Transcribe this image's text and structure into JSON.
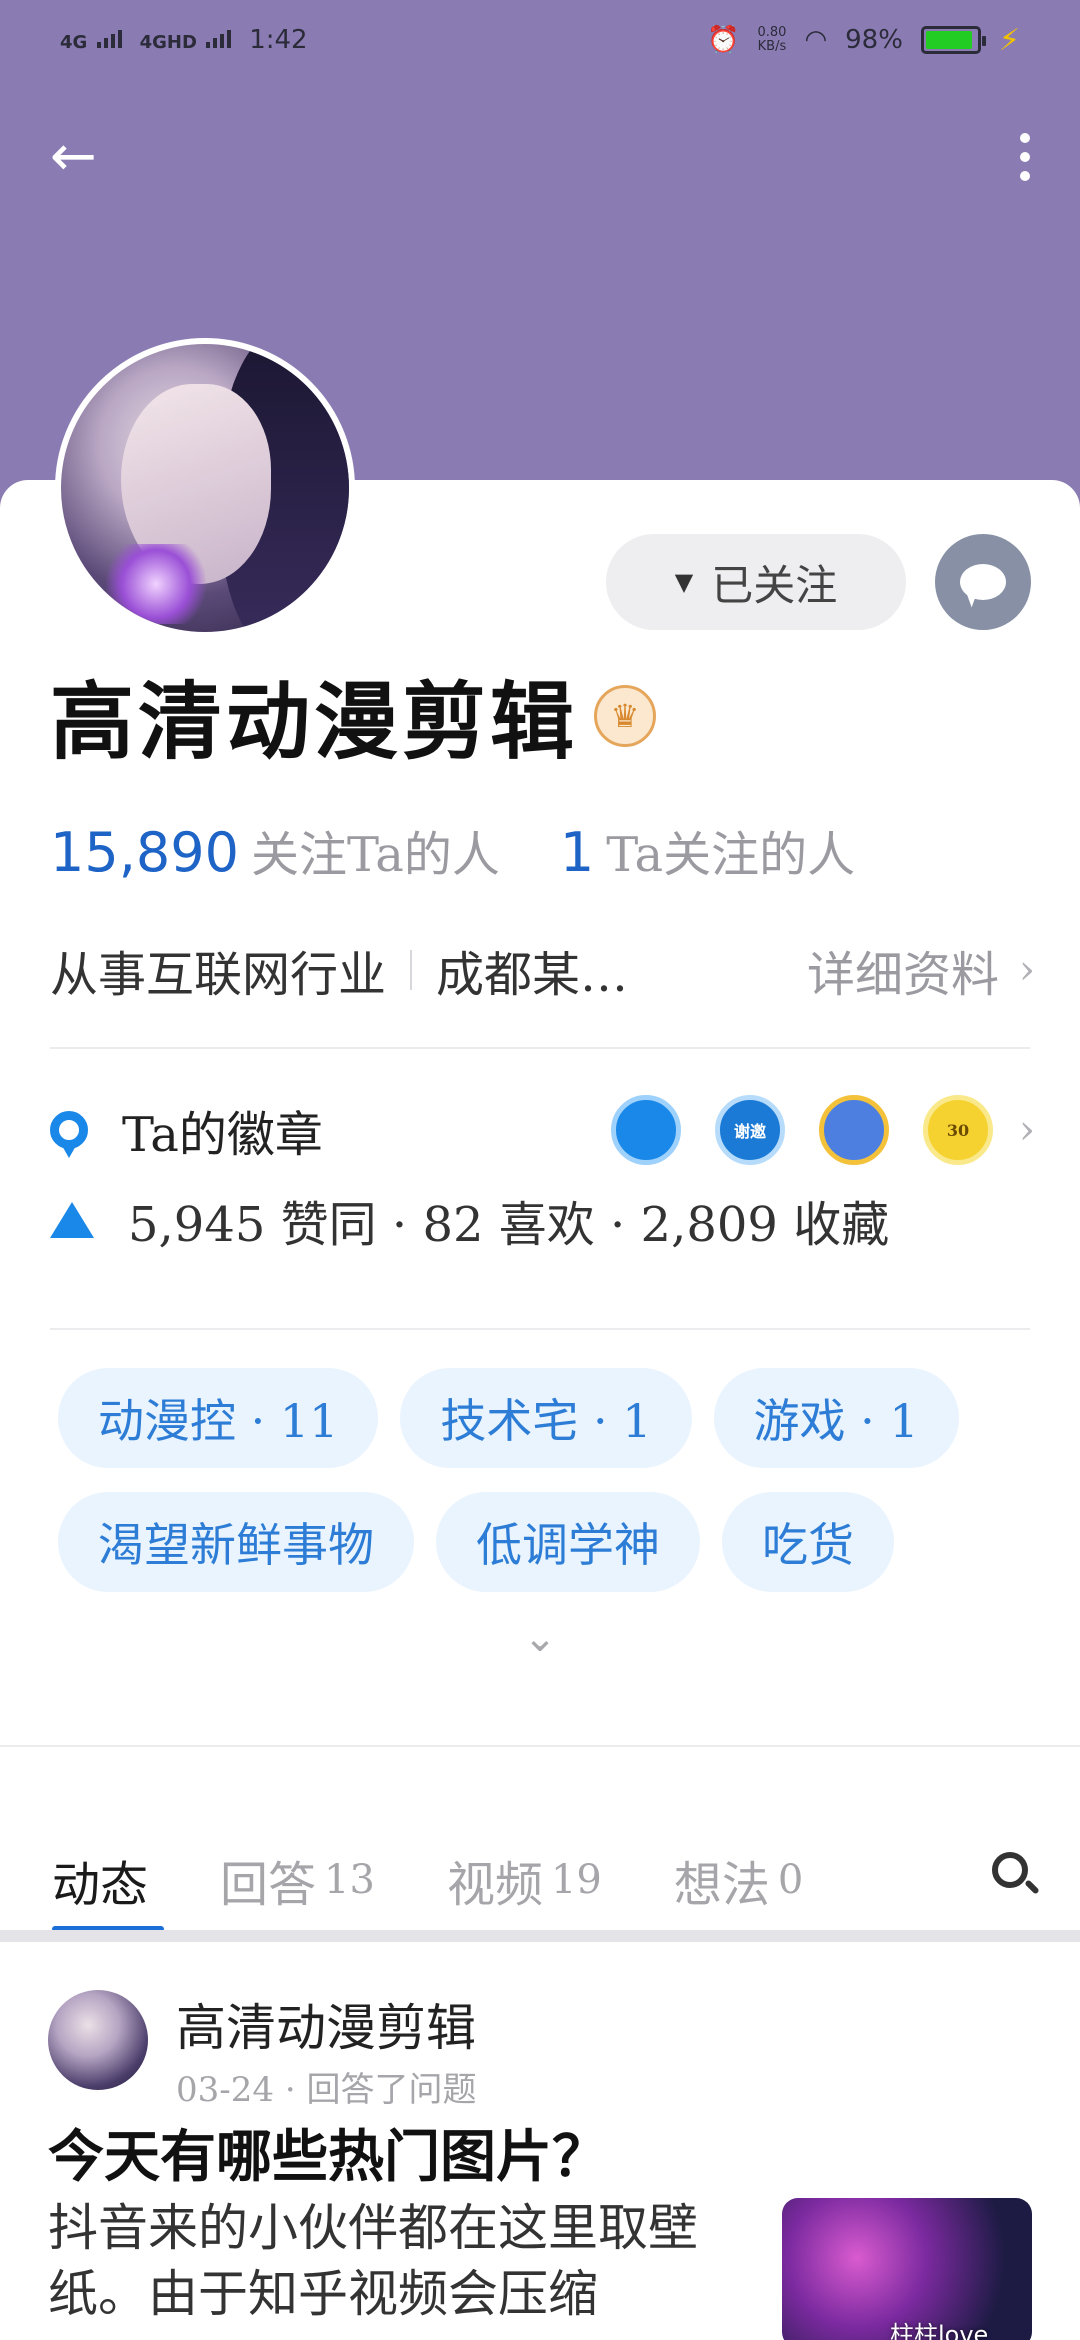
{
  "status_bar": {
    "network1": "4G",
    "network2": "4GHD",
    "time": "1:42",
    "speed_value": "0.80",
    "speed_unit": "KB/s",
    "battery": "98%"
  },
  "profile": {
    "name": "高清动漫剪辑",
    "follow_label": "已关注",
    "followers_count": "15,890",
    "followers_label": "关注Ta的人",
    "following_count": "1",
    "following_label": "Ta关注的人",
    "industry": "从事互联网行业",
    "location": "成都某…",
    "detail_link": "详细资料",
    "badges_label": "Ta的徽章",
    "badge_texts": [
      "",
      "谢邀",
      "",
      "30"
    ],
    "likes_text": "5,945 赞同 · 82 喜欢 · 2,809 收藏"
  },
  "tags": [
    "动漫控 · 11",
    "技术宅 · 1",
    "游戏 · 1",
    "渴望新鲜事物",
    "低调学神",
    "吃货"
  ],
  "tabs": [
    {
      "label": "动态",
      "count": ""
    },
    {
      "label": "回答",
      "count": "13"
    },
    {
      "label": "视频",
      "count": "19"
    },
    {
      "label": "想法",
      "count": "0"
    }
  ],
  "post": {
    "author": "高清动漫剪辑",
    "meta": "03-24 · 回答了问题",
    "title": "今天有哪些热门图片？",
    "excerpt": "抖音来的小伙伴都在这里取壁纸。由于知乎视频会压缩"
  },
  "watermark": "柱柱love",
  "colors": {
    "header": "#8a7cb3",
    "accent": "#1a70d8",
    "tag_bg": "#e9f4fe"
  }
}
